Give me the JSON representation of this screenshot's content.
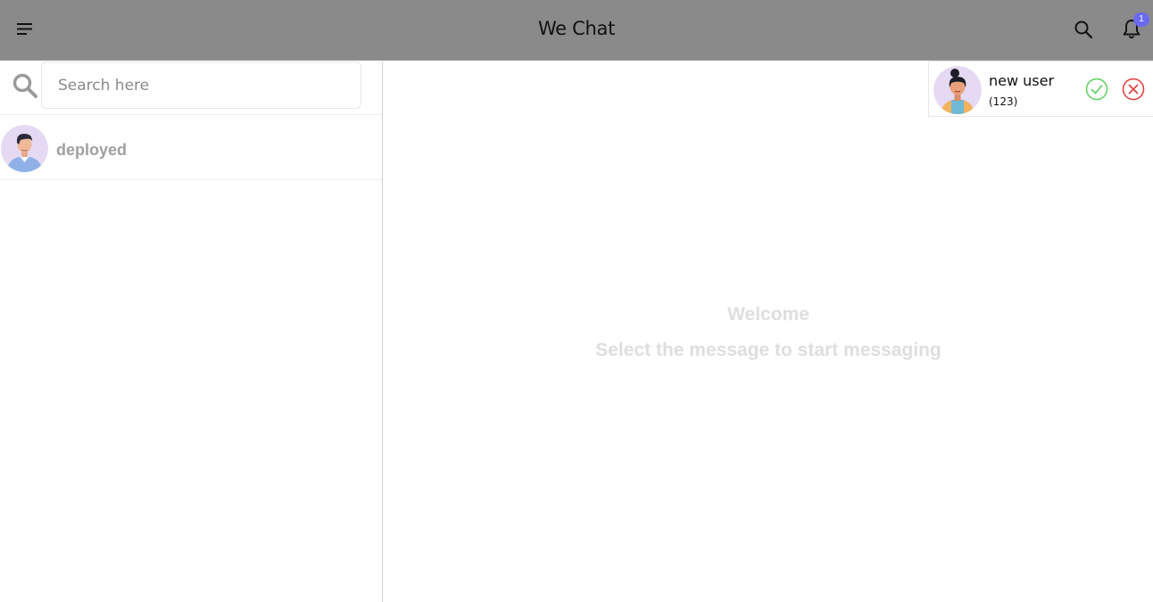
{
  "header": {
    "title": "We Chat",
    "notification_count": "1",
    "icons": [
      "menu-icon",
      "search-icon",
      "bell-icon"
    ]
  },
  "sidebar": {
    "search": {
      "placeholder": "Search here",
      "value": ""
    },
    "conversations": [
      {
        "name": "deployed",
        "avatar": "male-avatar"
      }
    ]
  },
  "main": {
    "welcome_title": "Welcome",
    "welcome_subtitle": "Select the message to start messaging"
  },
  "friend_request": {
    "name": "new user",
    "detail": "(123)",
    "avatar": "female-avatar",
    "icons": [
      "check-circle-icon",
      "x-circle-icon"
    ]
  },
  "colors": {
    "header_bg": "#8a8a8a",
    "badge": "#6a6af0",
    "accept": "#5ad15a",
    "reject": "#e03a3a",
    "muted_text": "#dedede"
  }
}
